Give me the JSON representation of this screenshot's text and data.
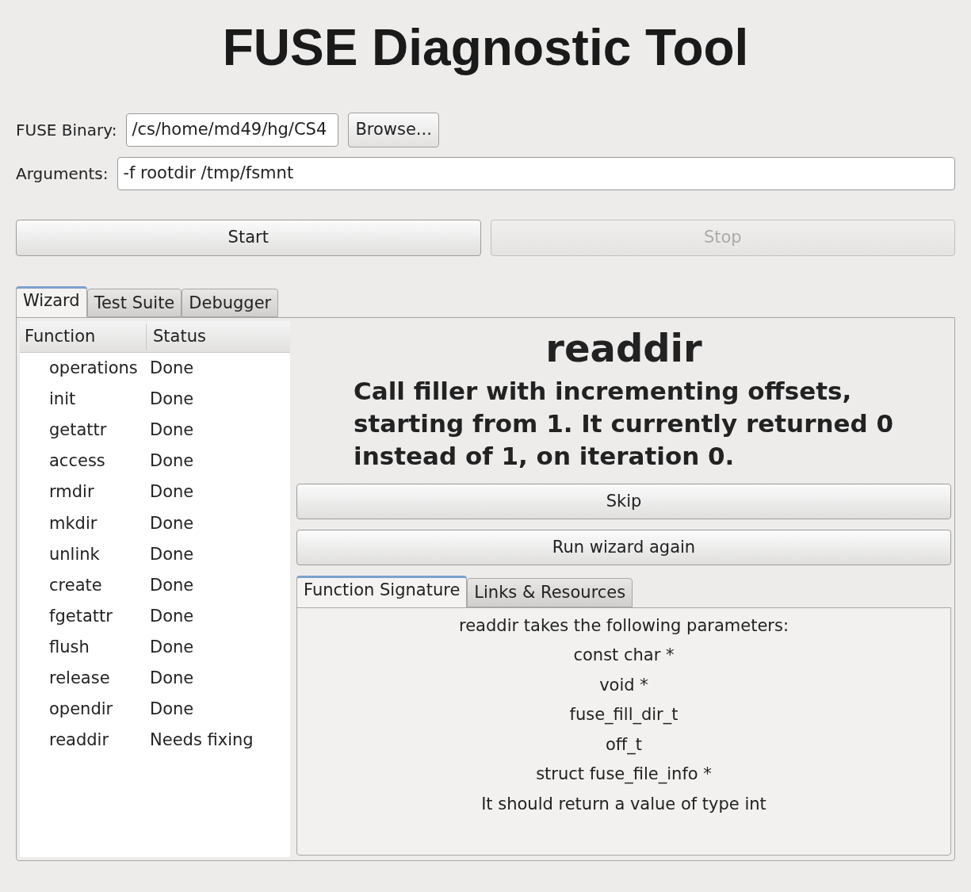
{
  "title": "FUSE Diagnostic Tool",
  "binary": {
    "label": "FUSE Binary:",
    "value": "/cs/home/md49/hg/CS4",
    "browse": "Browse..."
  },
  "arguments": {
    "label": "Arguments:",
    "value": "-f rootdir /tmp/fsmnt"
  },
  "controls": [
    {
      "label": "Start",
      "disabled": false
    },
    {
      "label": "Stop",
      "disabled": true
    }
  ],
  "tabs": [
    {
      "label": "Wizard",
      "selected": true
    },
    {
      "label": "Test Suite",
      "selected": false
    },
    {
      "label": "Debugger",
      "selected": false
    }
  ],
  "table": {
    "columns": [
      "Function",
      "Status"
    ],
    "rows": [
      {
        "function": "operations",
        "status": "Done"
      },
      {
        "function": "init",
        "status": "Done"
      },
      {
        "function": "getattr",
        "status": "Done"
      },
      {
        "function": "access",
        "status": "Done"
      },
      {
        "function": "rmdir",
        "status": "Done"
      },
      {
        "function": "mkdir",
        "status": "Done"
      },
      {
        "function": "unlink",
        "status": "Done"
      },
      {
        "function": "create",
        "status": "Done"
      },
      {
        "function": "fgetattr",
        "status": "Done"
      },
      {
        "function": "flush",
        "status": "Done"
      },
      {
        "function": "release",
        "status": "Done"
      },
      {
        "function": "opendir",
        "status": "Done"
      },
      {
        "function": "readdir",
        "status": "Needs fixing"
      }
    ]
  },
  "wizard": {
    "heading": "readdir",
    "message": "Call filler with incrementing offsets, starting from 1. It currently returned 0 instead of 1, on iteration 0.",
    "buttons": [
      "Skip",
      "Run wizard again"
    ],
    "tabs": [
      {
        "label": "Function Signature",
        "selected": true
      },
      {
        "label": "Links & Resources",
        "selected": false
      }
    ],
    "signature_lines": [
      "readdir takes the following parameters:",
      "const char *",
      "void *",
      "fuse_fill_dir_t",
      "off_t",
      "struct fuse_file_info *",
      "It should return a value of type int"
    ]
  }
}
